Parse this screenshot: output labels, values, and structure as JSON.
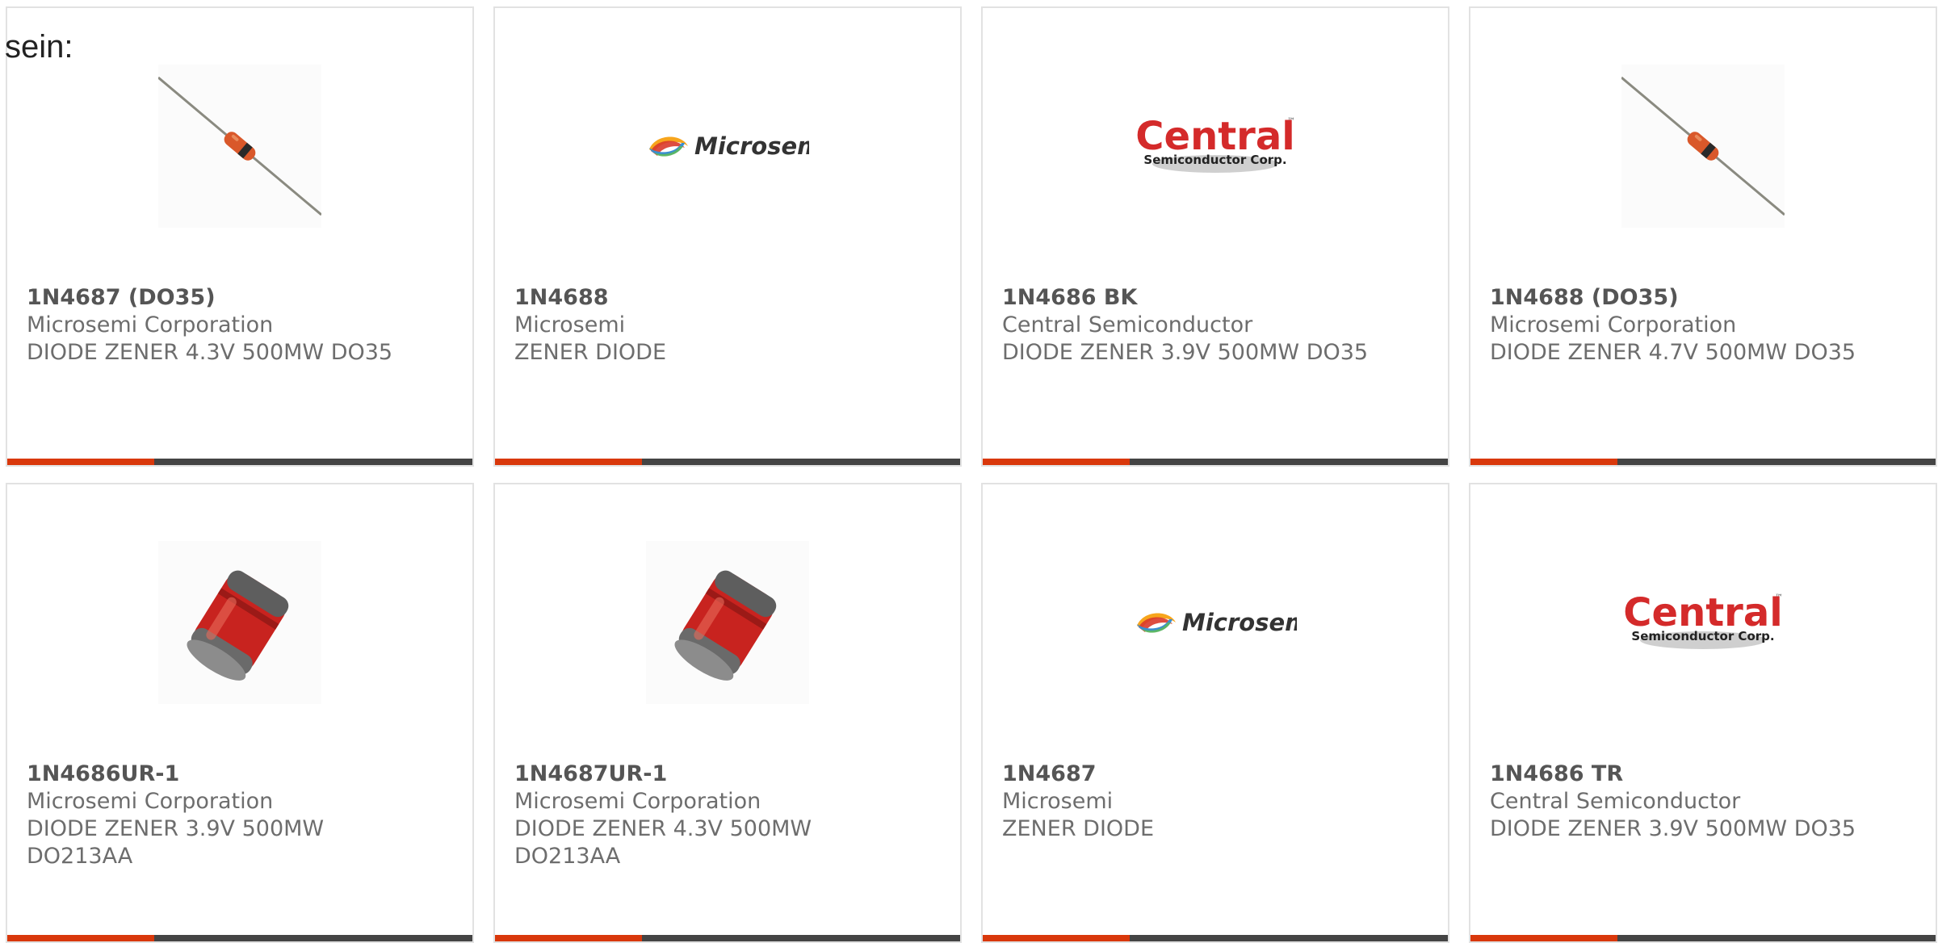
{
  "intro_text": "sein:",
  "colors": {
    "accent": "#d9380b",
    "bar": "#444444",
    "border": "#e2e2e2",
    "text": "#6d6d6d"
  },
  "logos": {
    "microsemi": "Microsemi",
    "central_main": "Central",
    "central_tm": "™",
    "central_sub": "Semiconductor Corp."
  },
  "products": [
    {
      "part": "1N4687 (DO35)",
      "maker": "Microsemi Corporation",
      "desc": [
        "DIODE ZENER 4.3V 500MW DO35"
      ],
      "image": "axial-diode-icon"
    },
    {
      "part": "1N4688",
      "maker": "Microsemi",
      "desc": [
        "ZENER DIODE"
      ],
      "image": "microsemi-logo"
    },
    {
      "part": "1N4686 BK",
      "maker": "Central Semiconductor",
      "desc": [
        "DIODE ZENER 3.9V 500MW DO35"
      ],
      "image": "central-logo"
    },
    {
      "part": "1N4688 (DO35)",
      "maker": "Microsemi Corporation",
      "desc": [
        "DIODE ZENER 4.7V 500MW DO35"
      ],
      "image": "axial-diode-icon"
    },
    {
      "part": "1N4686UR-1",
      "maker": "Microsemi Corporation",
      "desc": [
        "DIODE ZENER 3.9V 500MW",
        "DO213AA"
      ],
      "image": "melf-diode-icon"
    },
    {
      "part": "1N4687UR-1",
      "maker": "Microsemi Corporation",
      "desc": [
        "DIODE ZENER 4.3V 500MW",
        "DO213AA"
      ],
      "image": "melf-diode-icon"
    },
    {
      "part": "1N4687",
      "maker": "Microsemi",
      "desc": [
        "ZENER DIODE"
      ],
      "image": "microsemi-logo"
    },
    {
      "part": "1N4686 TR",
      "maker": "Central Semiconductor",
      "desc": [
        "DIODE ZENER 3.9V 500MW DO35"
      ],
      "image": "central-logo"
    }
  ]
}
